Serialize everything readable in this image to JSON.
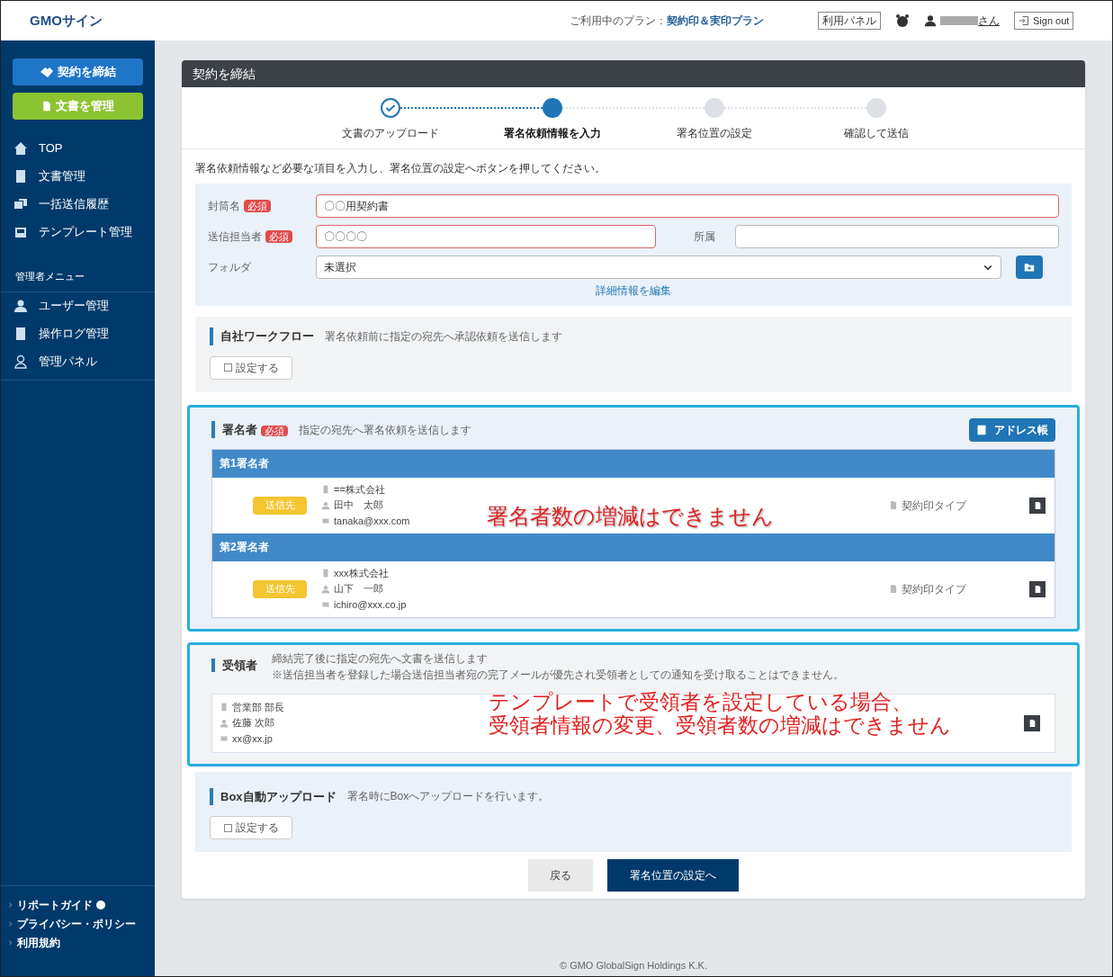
{
  "header": {
    "logo": "GMOサイン",
    "plan_label": "ご利用中のプラン：",
    "plan_name": "契約印＆実印プラン",
    "panel_button": "利用パネル",
    "user_suffix": "さん",
    "signout": "Sign out"
  },
  "sidebar": {
    "primary_buttons": [
      {
        "label": "契約を締結",
        "kind": "contract"
      },
      {
        "label": "文書を管理",
        "kind": "documents"
      }
    ],
    "nav": [
      {
        "label": "TOP",
        "kind": "home"
      },
      {
        "label": "文書管理",
        "kind": "doc"
      },
      {
        "label": "一括送信履歴",
        "kind": "bulk"
      },
      {
        "label": "テンプレート管理",
        "kind": "template"
      }
    ],
    "admin_heading": "管理者メニュー",
    "admin_nav": [
      {
        "label": "ユーザー管理",
        "kind": "user"
      },
      {
        "label": "操作ログ管理",
        "kind": "doc"
      },
      {
        "label": "管理パネル",
        "kind": "panel"
      }
    ],
    "footer_links": [
      {
        "label": "リポートガイド",
        "help": true
      },
      {
        "label": "プライバシー・ポリシー",
        "help": false
      },
      {
        "label": "利用規約",
        "help": false
      }
    ]
  },
  "main": {
    "title": "契約を締結",
    "steps": [
      {
        "label": "文書のアップロード",
        "completed": true,
        "selected": false
      },
      {
        "label": "署名依頼情報を入力",
        "completed": false,
        "selected": true
      },
      {
        "label": "署名位置の設定",
        "completed": false,
        "selected": false
      },
      {
        "label": "確認して送信",
        "completed": false,
        "selected": false
      }
    ],
    "instruction": "署名依頼情報など必要な項目を入力し、署名位置の設定へボタンを押してください。",
    "envelope": {
      "label": "封筒名",
      "required": true,
      "badge": "必須",
      "value": "〇〇用契約書"
    },
    "sender": {
      "label": "送信担当者",
      "required": true,
      "badge": "必須",
      "value": "〇〇〇〇"
    },
    "affiliation": {
      "label": "所属"
    },
    "folder": {
      "label": "フォルダ",
      "value": "未選択"
    },
    "detail_link": "詳細情報を編集",
    "workflow": {
      "title": "自社ワークフロー",
      "description": "署名依頼前に指定の宛先へ承認依頼を送信します",
      "option": {
        "label": "設定する",
        "checked": false
      }
    },
    "signers": {
      "title": "署名者",
      "badge": "必須",
      "description": "指定の宛先へ署名依頼を送信します",
      "address_button": "アドレス帳",
      "items": [
        {
          "heading": "第1署名者",
          "tag": "送信先",
          "company": "==株式会社",
          "name": "田中　太郎",
          "email": "tanaka@xxx.com",
          "seal_type": "契約印タイプ"
        },
        {
          "heading": "第2署名者",
          "tag": "送信先",
          "company": "xxx株式会社",
          "name": "山下　一郎",
          "email": "ichiro@xxx.co.jp",
          "seal_type": "契約印タイプ"
        }
      ]
    },
    "recipient": {
      "title": "受領者",
      "description": "締結完了後に指定の宛先へ文書を送信します",
      "note": "※送信担当者を登録した場合送信担当者宛の完了メールが優先され受領者としての通知を受け取ることはできません。",
      "company": "営業部 部長",
      "name": "佐藤 次郎",
      "email": "xx@xx.jp"
    },
    "box": {
      "title": "Box自動アップロード",
      "description": "署名時にBoxへアップロードを行います。",
      "option": {
        "label": "設定する",
        "checked": false
      }
    },
    "back_button": "戻る",
    "next_button": "署名位置の設定へ"
  },
  "annotations": {
    "signers": [
      "署名者数の増減はできません"
    ],
    "recipient": [
      "テンプレートで受領者を設定している場合、",
      "受領者情報の変更、受領者数の増減はできません"
    ]
  },
  "copyright": "© GMO GlobalSign Holdings K.K."
}
